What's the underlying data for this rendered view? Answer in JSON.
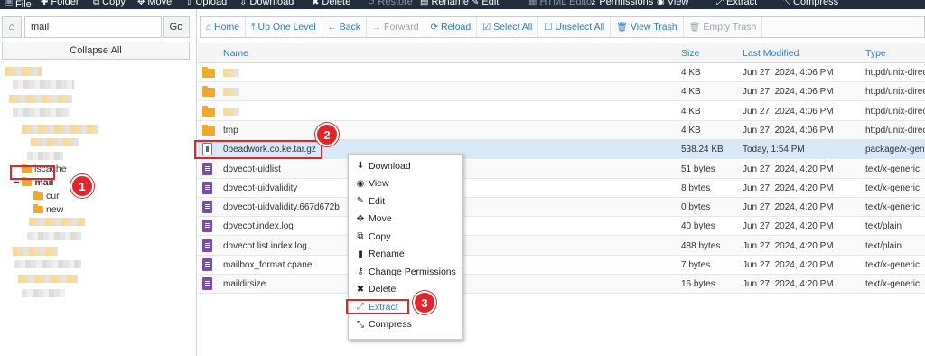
{
  "topbar": {
    "items": [
      {
        "icon": "file-icon",
        "glyph": "🗎",
        "label": "File",
        "enabled": true
      },
      {
        "icon": "plus-icon",
        "glyph": "✚",
        "label": "Folder",
        "enabled": true
      },
      {
        "icon": "copy-icon",
        "glyph": "⧉",
        "label": "Copy",
        "enabled": true
      },
      {
        "icon": "move-icon",
        "glyph": "✥",
        "label": "Move",
        "enabled": true
      },
      {
        "icon": "upload-icon",
        "glyph": "⇧",
        "label": "Upload",
        "enabled": true
      },
      {
        "icon": "download-icon",
        "glyph": "⇩",
        "label": "Download",
        "enabled": true
      },
      {
        "icon": "delete-icon",
        "glyph": "✖",
        "label": "Delete",
        "enabled": true
      },
      {
        "icon": "restore-icon",
        "glyph": "↺",
        "label": "Restore",
        "enabled": false
      },
      {
        "icon": "rename-icon",
        "glyph": "▤",
        "label": "Rename",
        "enabled": true
      },
      {
        "icon": "edit-icon",
        "glyph": "✎",
        "label": "Edit",
        "enabled": true
      },
      {
        "icon": "html-editor-icon",
        "glyph": "▦",
        "label": "HTML Editor",
        "enabled": false
      },
      {
        "icon": "key-icon",
        "glyph": "⚷",
        "label": "Permissions",
        "enabled": true
      },
      {
        "icon": "eye-icon",
        "glyph": "◉",
        "label": "View",
        "enabled": true
      },
      {
        "icon": "extract-icon",
        "glyph": "⤢",
        "label": "Extract",
        "enabled": true
      },
      {
        "icon": "compress-icon",
        "glyph": "⤡",
        "label": "Compress",
        "enabled": true
      }
    ]
  },
  "left_panel": {
    "home_icon": "home-icon",
    "path_value": "mail",
    "go_label": "Go",
    "collapse_label": "Collapse All",
    "tree": {
      "lscache": "lscache",
      "mail": "mail",
      "cur": "cur",
      "new": "new"
    },
    "badges": {
      "one": "1",
      "two": "2",
      "three": "3"
    }
  },
  "actions": [
    {
      "icon": "home-icon",
      "glyph": "⌂",
      "label": "Home",
      "enabled": true
    },
    {
      "icon": "up-level-icon",
      "glyph": "⤒",
      "label": "Up One Level",
      "enabled": true
    },
    {
      "icon": "back-icon",
      "glyph": "←",
      "label": "Back",
      "enabled": true
    },
    {
      "icon": "forward-icon",
      "glyph": "→",
      "label": "Forward",
      "enabled": false
    },
    {
      "icon": "reload-icon",
      "glyph": "⟳",
      "label": "Reload",
      "enabled": true
    },
    {
      "icon": "check-square-icon",
      "glyph": "☑",
      "label": "Select All",
      "enabled": true
    },
    {
      "icon": "square-icon",
      "glyph": "☐",
      "label": "Unselect All",
      "enabled": true
    },
    {
      "icon": "trash-icon",
      "glyph": "🗑",
      "label": "View Trash",
      "enabled": true
    },
    {
      "icon": "trash-icon",
      "glyph": "🗑",
      "label": "Empty Trash",
      "enabled": false
    }
  ],
  "table": {
    "headers": {
      "name": "Name",
      "size": "Size",
      "modified": "Last Modified",
      "type": "Type"
    },
    "rows": [
      {
        "kind": "folder",
        "name": "",
        "size": "4 KB",
        "modified": "Jun 27, 2024, 4:06 PM",
        "type": "httpd/unix-directory"
      },
      {
        "kind": "folder",
        "name": "",
        "size": "4 KB",
        "modified": "Jun 27, 2024, 4:06 PM",
        "type": "httpd/unix-directory"
      },
      {
        "kind": "folder",
        "name": "",
        "size": "4 KB",
        "modified": "Jun 27, 2024, 4:06 PM",
        "type": "httpd/unix-directory"
      },
      {
        "kind": "folder",
        "name": "tmp",
        "size": "4 KB",
        "modified": "Jun 27, 2024, 4:06 PM",
        "type": "httpd/unix-directory"
      },
      {
        "kind": "package",
        "name": "0beadwork.co.ke.tar.gz",
        "size": "538.24 KB",
        "modified": "Today, 1:54 PM",
        "type": "package/x-generic"
      },
      {
        "kind": "text",
        "name": "dovecot-uidlist",
        "size": "51 bytes",
        "modified": "Jun 27, 2024, 4:20 PM",
        "type": "text/x-generic"
      },
      {
        "kind": "text",
        "name": "dovecot-uidvalidity",
        "size": "8 bytes",
        "modified": "Jun 27, 2024, 4:20 PM",
        "type": "text/x-generic"
      },
      {
        "kind": "text",
        "name": "dovecot-uidvalidity.667d672b",
        "size": "0 bytes",
        "modified": "Jun 27, 2024, 4:20 PM",
        "type": "text/x-generic"
      },
      {
        "kind": "text",
        "name": "dovecot.index.log",
        "size": "40 bytes",
        "modified": "Jun 27, 2024, 4:20 PM",
        "type": "text/plain"
      },
      {
        "kind": "text",
        "name": "dovecot.list.index.log",
        "size": "488 bytes",
        "modified": "Jun 27, 2024, 4:20 PM",
        "type": "text/plain"
      },
      {
        "kind": "text",
        "name": "mailbox_format.cpanel",
        "size": "7 bytes",
        "modified": "Jun 27, 2024, 4:20 PM",
        "type": "text/x-generic"
      },
      {
        "kind": "text",
        "name": "maildirsize",
        "size": "16 bytes",
        "modified": "Jun 27, 2024, 4:20 PM",
        "type": "text/x-generic"
      }
    ]
  },
  "context_menu": [
    {
      "icon": "download-icon",
      "glyph": "⬇",
      "label": "Download"
    },
    {
      "icon": "eye-icon",
      "glyph": "◉",
      "label": "View"
    },
    {
      "icon": "pencil-icon",
      "glyph": "✎",
      "label": "Edit"
    },
    {
      "icon": "move-icon",
      "glyph": "✥",
      "label": "Move"
    },
    {
      "icon": "copy-icon",
      "glyph": "⧉",
      "label": "Copy"
    },
    {
      "icon": "file-icon",
      "glyph": "▮",
      "label": "Rename"
    },
    {
      "icon": "key-icon",
      "glyph": "⚷",
      "label": "Change Permissions"
    },
    {
      "icon": "close-icon",
      "glyph": "✖",
      "label": "Delete"
    },
    {
      "icon": "extract-icon",
      "glyph": "⤢",
      "label": "Extract"
    },
    {
      "icon": "compress-icon",
      "glyph": "⤡",
      "label": "Compress"
    }
  ],
  "colors": {
    "accent": "#2b7bbf",
    "highlight": "#e0252b",
    "selected_row": "#d7e8f7",
    "folder": "#f0a830"
  }
}
